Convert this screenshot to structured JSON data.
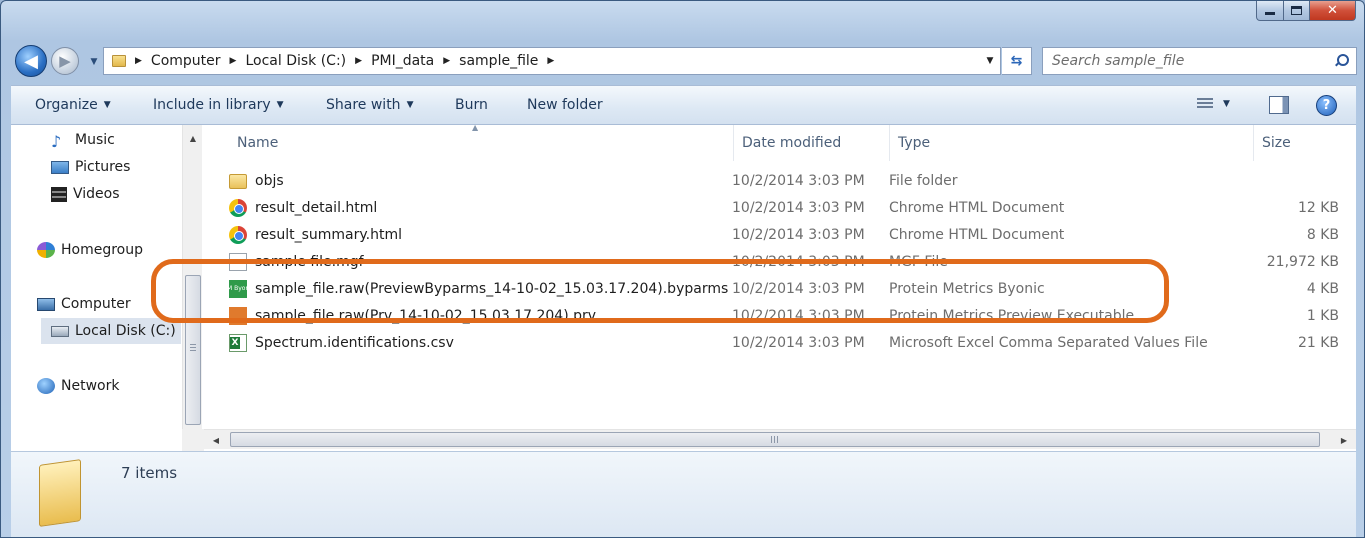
{
  "window": {
    "close_glyph": "✕"
  },
  "nav": {
    "back_glyph": "◀",
    "forward_glyph": "▶"
  },
  "address": {
    "crumbs": [
      "Computer",
      "Local Disk (C:)",
      "PMI_data",
      "sample_file"
    ]
  },
  "search": {
    "placeholder": "Search sample_file"
  },
  "toolbar": {
    "organize": "Organize",
    "include_in_library": "Include in library",
    "share_with": "Share with",
    "burn": "Burn",
    "new_folder": "New folder",
    "help": "?"
  },
  "sidebar": {
    "items": [
      {
        "label": "Music",
        "icon": "music-icon"
      },
      {
        "label": "Pictures",
        "icon": "pictures-icon"
      },
      {
        "label": "Videos",
        "icon": "videos-icon"
      },
      {
        "label": "Homegroup",
        "icon": "homegroup-icon"
      },
      {
        "label": "Computer",
        "icon": "computer-icon"
      },
      {
        "label": "Local Disk (C:)",
        "icon": "disk-icon",
        "selected": true
      },
      {
        "label": "Network",
        "icon": "network-icon"
      }
    ]
  },
  "columns": {
    "name": "Name",
    "date": "Date modified",
    "type": "Type",
    "size": "Size"
  },
  "files": [
    {
      "name": "objs",
      "date": "10/2/2014 3:03 PM",
      "type": "File folder",
      "size": "",
      "icon": "folder-icon"
    },
    {
      "name": "result_detail.html",
      "date": "10/2/2014 3:03 PM",
      "type": "Chrome HTML Document",
      "size": "12 KB",
      "icon": "chrome-icon"
    },
    {
      "name": "result_summary.html",
      "date": "10/2/2014 3:03 PM",
      "type": "Chrome HTML Document",
      "size": "8 KB",
      "icon": "chrome-icon"
    },
    {
      "name": "sample file.mgf",
      "date": "10/2/2014 3:03 PM",
      "type": "MGF File",
      "size": "21,972 KB",
      "icon": "document-icon"
    },
    {
      "name": "sample_file.raw(PreviewByparms_14-10-02_15.03.17.204).byparms",
      "date": "10/2/2014 3:03 PM",
      "type": "Protein Metrics Byonic",
      "size": "4 KB",
      "icon": "byonic-icon"
    },
    {
      "name": "sample_file.raw(Prv_14-10-02_15.03.17.204).prv",
      "date": "10/2/2014 3:03 PM",
      "type": "Protein Metrics Preview Executable",
      "size": "1 KB",
      "icon": "preview-exe-icon"
    },
    {
      "name": "Spectrum.identifications.csv",
      "date": "10/2/2014 3:03 PM",
      "type": "Microsoft Excel Comma Separated Values File",
      "size": "21 KB",
      "icon": "excel-icon"
    }
  ],
  "byonic_icon_text": "PM Byonc",
  "scroll": {
    "hgrip": "III"
  },
  "status": {
    "item_count": "7 items"
  },
  "colors": {
    "highlight": "#e06a1b"
  }
}
